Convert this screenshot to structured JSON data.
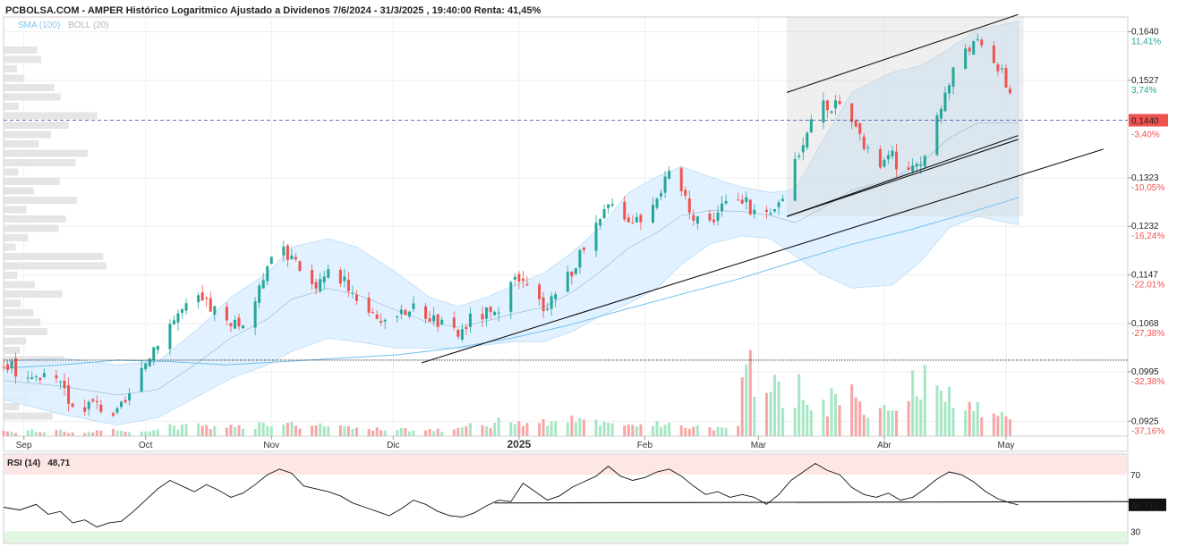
{
  "header": {
    "title": "PCBOLSA.COM - AMPER Histórico Logaritmico Ajustado a Dividenos 7/6/2024 - 31/3/2025 , 19:40:00 Renta: 41,45%",
    "indicator_sma": "SMA (100)",
    "indicator_boll": "BOLL (20)"
  },
  "colors": {
    "up": "#26a69a",
    "down": "#ef5350",
    "band_fill": "#dcefff",
    "sma": "#6fc0ee",
    "trend": "#111111",
    "price_line": "#3344aa",
    "vol_up": "#a6e6c4",
    "vol_down": "#f7a5a5",
    "rsi_line": "#111111",
    "rsi_over": "#fde6e6",
    "rsi_under": "#e2f7e2"
  },
  "chart_data": {
    "type": "candlestick",
    "x_range": [
      "2024-08-27",
      "2025-05-31"
    ],
    "y_scale": "log",
    "ylim": [
      0.0905,
      0.1676
    ],
    "y_ticks": [
      {
        "value": "0,1640",
        "pct": "11,41%"
      },
      {
        "value": "0,1527",
        "pct": "3,74%"
      },
      {
        "value": "0,1323",
        "pct": "-10,05%"
      },
      {
        "value": "0,1232",
        "pct": "-16,24%"
      },
      {
        "value": "0,1147",
        "pct": "-22,01%"
      },
      {
        "value": "0,1068",
        "pct": "-27,38%"
      },
      {
        "value": "0,0995",
        "pct": "-32,38%"
      },
      {
        "value": "0,0925",
        "pct": "-37,16%"
      }
    ],
    "y_tick_values": [
      0.164,
      0.1527,
      0.1323,
      0.1232,
      0.1147,
      0.1068,
      0.0995,
      0.0925
    ],
    "last_price": {
      "label": "0,1440",
      "pct": "-3,40%",
      "value": 0.144
    },
    "support_level": 0.1012,
    "x_ticks": [
      {
        "label": "Sep",
        "date": "2024-09-01",
        "bold": false
      },
      {
        "label": "Oct",
        "date": "2024-10-01",
        "bold": false
      },
      {
        "label": "Nov",
        "date": "2024-11-01",
        "bold": false
      },
      {
        "label": "Dic",
        "date": "2024-12-01",
        "bold": false
      },
      {
        "label": "2025",
        "date": "2025-01-01",
        "bold": true
      },
      {
        "label": "Feb",
        "date": "2025-02-01",
        "bold": false
      },
      {
        "label": "Mar",
        "date": "2025-03-01",
        "bold": false
      },
      {
        "label": "Abr",
        "date": "2025-04-01",
        "bold": false
      },
      {
        "label": "May",
        "date": "2025-05-01",
        "bold": false
      }
    ],
    "close_series": [
      [
        "2024-08-27",
        0.1005
      ],
      [
        "2024-09-03",
        0.099
      ],
      [
        "2024-09-10",
        0.0975
      ],
      [
        "2024-09-13",
        0.0945
      ],
      [
        "2024-09-18",
        0.095
      ],
      [
        "2024-09-24",
        0.0935
      ],
      [
        "2024-09-27",
        0.096
      ],
      [
        "2024-09-30",
        0.099
      ],
      [
        "2024-10-01",
        0.101
      ],
      [
        "2024-10-04",
        0.1045
      ],
      [
        "2024-10-09",
        0.1085
      ],
      [
        "2024-10-14",
        0.1105
      ],
      [
        "2024-10-18",
        0.109
      ],
      [
        "2024-10-22",
        0.106
      ],
      [
        "2024-10-25",
        0.107
      ],
      [
        "2024-10-29",
        0.112
      ],
      [
        "2024-10-31",
        0.1175
      ],
      [
        "2024-11-04",
        0.12
      ],
      [
        "2024-11-06",
        0.117
      ],
      [
        "2024-11-11",
        0.113
      ],
      [
        "2024-11-15",
        0.115
      ],
      [
        "2024-11-19",
        0.114
      ],
      [
        "2024-11-22",
        0.111
      ],
      [
        "2024-11-27",
        0.108
      ],
      [
        "2024-12-02",
        0.107
      ],
      [
        "2024-12-05",
        0.1095
      ],
      [
        "2024-12-10",
        0.108
      ],
      [
        "2024-12-14",
        0.106
      ],
      [
        "2024-12-17",
        0.105
      ],
      [
        "2024-12-20",
        0.1075
      ],
      [
        "2024-12-24",
        0.1085
      ],
      [
        "2024-12-27",
        0.1075
      ],
      [
        "2024-12-31",
        0.114
      ],
      [
        "2025-01-03",
        0.1125
      ],
      [
        "2025-01-07",
        0.1095
      ],
      [
        "2025-01-10",
        0.112
      ],
      [
        "2025-01-14",
        0.1155
      ],
      [
        "2025-01-17",
        0.119
      ],
      [
        "2025-01-21",
        0.124
      ],
      [
        "2025-01-24",
        0.1285
      ],
      [
        "2025-01-28",
        0.1245
      ],
      [
        "2025-01-31",
        0.125
      ],
      [
        "2025-02-04",
        0.1295
      ],
      [
        "2025-02-07",
        0.1325
      ],
      [
        "2025-02-10",
        0.13
      ],
      [
        "2025-02-13",
        0.1255
      ],
      [
        "2025-02-17",
        0.124
      ],
      [
        "2025-02-20",
        0.127
      ],
      [
        "2025-02-25",
        0.128
      ],
      [
        "2025-02-28",
        0.126
      ],
      [
        "2025-03-04",
        0.1245
      ],
      [
        "2025-03-07",
        0.129
      ],
      [
        "2025-03-10",
        0.136
      ],
      [
        "2025-03-13",
        0.142
      ],
      [
        "2025-03-16",
        0.148
      ],
      [
        "2025-03-20",
        0.147
      ],
      [
        "2025-03-24",
        0.143
      ],
      [
        "2025-03-27",
        0.138
      ],
      [
        "2025-03-31",
        0.135
      ],
      [
        "2025-04-03",
        0.1365
      ],
      [
        "2025-04-06",
        0.133
      ],
      [
        "2025-04-10",
        0.134
      ],
      [
        "2025-04-14",
        0.1455
      ],
      [
        "2025-04-17",
        0.152
      ],
      [
        "2025-04-20",
        0.1605
      ],
      [
        "2025-04-24",
        0.161
      ],
      [
        "2025-04-27",
        0.1595
      ],
      [
        "2025-04-30",
        0.154
      ],
      [
        "2025-05-02",
        0.15
      ],
      [
        "2025-05-04",
        0.144
      ]
    ],
    "bollinger": {
      "upper": [
        [
          "2024-08-27",
          0.101
        ],
        [
          "2024-09-10",
          0.1015
        ],
        [
          "2024-09-24",
          0.1005
        ],
        [
          "2024-10-04",
          0.101
        ],
        [
          "2024-10-14",
          0.106
        ],
        [
          "2024-10-22",
          0.111
        ],
        [
          "2024-10-31",
          0.115
        ],
        [
          "2024-11-06",
          0.1195
        ],
        [
          "2024-11-15",
          0.121
        ],
        [
          "2024-11-22",
          0.1195
        ],
        [
          "2024-12-02",
          0.115
        ],
        [
          "2024-12-10",
          0.111
        ],
        [
          "2024-12-17",
          0.1095
        ],
        [
          "2024-12-24",
          0.111
        ],
        [
          "2024-12-31",
          0.113
        ],
        [
          "2025-01-07",
          0.115
        ],
        [
          "2025-01-14",
          0.1185
        ],
        [
          "2025-01-21",
          0.123
        ],
        [
          "2025-01-28",
          0.1295
        ],
        [
          "2025-02-04",
          0.1325
        ],
        [
          "2025-02-10",
          0.1345
        ],
        [
          "2025-02-17",
          0.1325
        ],
        [
          "2025-02-25",
          0.1305
        ],
        [
          "2025-03-04",
          0.1295
        ],
        [
          "2025-03-10",
          0.13
        ],
        [
          "2025-03-16",
          0.1385
        ],
        [
          "2025-03-24",
          0.15
        ],
        [
          "2025-04-03",
          0.1545
        ],
        [
          "2025-04-10",
          0.156
        ],
        [
          "2025-04-17",
          0.16
        ],
        [
          "2025-04-24",
          0.1645
        ],
        [
          "2025-05-04",
          0.1665
        ]
      ],
      "lower": [
        [
          "2024-08-27",
          0.0955
        ],
        [
          "2024-09-10",
          0.0935
        ],
        [
          "2024-09-24",
          0.092
        ],
        [
          "2024-10-04",
          0.093
        ],
        [
          "2024-10-14",
          0.096
        ],
        [
          "2024-10-22",
          0.0985
        ],
        [
          "2024-10-31",
          0.1005
        ],
        [
          "2024-11-06",
          0.1025
        ],
        [
          "2024-11-15",
          0.1045
        ],
        [
          "2024-11-22",
          0.104
        ],
        [
          "2024-12-02",
          0.103
        ],
        [
          "2024-12-10",
          0.103
        ],
        [
          "2024-12-17",
          0.103
        ],
        [
          "2024-12-24",
          0.1035
        ],
        [
          "2024-12-31",
          0.104
        ],
        [
          "2025-01-07",
          0.104
        ],
        [
          "2025-01-14",
          0.1055
        ],
        [
          "2025-01-21",
          0.108
        ],
        [
          "2025-01-28",
          0.11
        ],
        [
          "2025-02-04",
          0.1125
        ],
        [
          "2025-02-10",
          0.1165
        ],
        [
          "2025-02-17",
          0.12
        ],
        [
          "2025-02-25",
          0.1215
        ],
        [
          "2025-03-04",
          0.121
        ],
        [
          "2025-03-10",
          0.118
        ],
        [
          "2025-03-16",
          0.115
        ],
        [
          "2025-03-24",
          0.1125
        ],
        [
          "2025-04-03",
          0.113
        ],
        [
          "2025-04-10",
          0.117
        ],
        [
          "2025-04-17",
          0.123
        ],
        [
          "2025-04-24",
          0.125
        ],
        [
          "2025-05-04",
          0.1235
        ]
      ]
    },
    "sma_100": [
      [
        "2024-08-27",
        0.1
      ],
      [
        "2024-09-10",
        0.1005
      ],
      [
        "2024-09-24",
        0.1012
      ],
      [
        "2024-10-07",
        0.101
      ],
      [
        "2024-10-21",
        0.1005
      ],
      [
        "2024-11-04",
        0.101
      ],
      [
        "2024-11-18",
        0.1015
      ],
      [
        "2024-12-02",
        0.102
      ],
      [
        "2024-12-16",
        0.103
      ],
      [
        "2024-12-30",
        0.1045
      ],
      [
        "2025-01-13",
        0.1065
      ],
      [
        "2025-01-27",
        0.109
      ],
      [
        "2025-02-10",
        0.1115
      ],
      [
        "2025-02-24",
        0.114
      ],
      [
        "2025-03-10",
        0.117
      ],
      [
        "2025-03-24",
        0.12
      ],
      [
        "2025-04-07",
        0.1225
      ],
      [
        "2025-04-21",
        0.1255
      ],
      [
        "2025-05-04",
        0.1285
      ]
    ],
    "trendlines": [
      {
        "from": [
          "2024-12-08",
          0.1008
        ],
        "to": [
          "2025-05-25",
          0.138
        ]
      },
      {
        "from": [
          "2025-03-08",
          0.125
        ],
        "to": [
          "2025-05-04",
          0.14
        ]
      },
      {
        "from": [
          "2025-03-08",
          0.15
        ],
        "to": [
          "2025-05-04",
          0.1682
        ]
      },
      {
        "from": [
          "2025-03-08",
          0.125
        ],
        "to": [
          "2025-05-04",
          0.1408
        ]
      }
    ],
    "volume": [
      0.05,
      0.04,
      0.05,
      0.06,
      0.05,
      0.07,
      0.06,
      0.04,
      0.03,
      0.04,
      0.05,
      0.06,
      0.05,
      0.04,
      0.05,
      0.06,
      0.08,
      0.1,
      0.09,
      0.11,
      0.12,
      0.1,
      0.09,
      0.12,
      0.11,
      0.1,
      0.09,
      0.12,
      0.1,
      0.11,
      0.13,
      0.09,
      0.1,
      0.12,
      0.11,
      0.09,
      0.08,
      0.1,
      0.09,
      0.07,
      0.08,
      0.06,
      0.07,
      0.05,
      0.06,
      0.07,
      0.08,
      0.06,
      0.07,
      0.1,
      0.12,
      0.1,
      0.14,
      0.16,
      0.15,
      0.13,
      0.12,
      0.14,
      0.16,
      0.15,
      0.18,
      0.16,
      0.14,
      0.13,
      0.12,
      0.11,
      0.1,
      0.12,
      0.14,
      0.12,
      0.1,
      0.11,
      0.12,
      0.1,
      0.09,
      0.08,
      0.1,
      0.09,
      0.55,
      0.7,
      0.4,
      0.62,
      0.48,
      0.35,
      0.5,
      0.38,
      0.3,
      0.26,
      0.4,
      0.45,
      0.35,
      0.28,
      0.22,
      0.25,
      0.3,
      0.28,
      0.55,
      0.42,
      0.6,
      0.48,
      0.4,
      0.3,
      0.35,
      0.28,
      0.26,
      0.24,
      0.22,
      0.18
    ],
    "rsi": {
      "label": "RSI (14)",
      "value": "48,71",
      "last_label": "48,713",
      "levels": [
        {
          "label": "70",
          "value": 70
        },
        {
          "label": "30",
          "value": 30
        }
      ],
      "ylim": [
        22,
        84
      ],
      "series": [
        [
          "2024-08-27",
          47
        ],
        [
          "2024-08-31",
          45
        ],
        [
          "2024-09-04",
          49
        ],
        [
          "2024-09-07",
          42
        ],
        [
          "2024-09-10",
          44
        ],
        [
          "2024-09-13",
          36
        ],
        [
          "2024-09-16",
          38
        ],
        [
          "2024-09-19",
          33
        ],
        [
          "2024-09-22",
          36
        ],
        [
          "2024-09-25",
          37
        ],
        [
          "2024-09-28",
          44
        ],
        [
          "2024-10-01",
          52
        ],
        [
          "2024-10-04",
          60
        ],
        [
          "2024-10-07",
          66
        ],
        [
          "2024-10-10",
          62
        ],
        [
          "2024-10-13",
          58
        ],
        [
          "2024-10-16",
          63
        ],
        [
          "2024-10-19",
          59
        ],
        [
          "2024-10-22",
          54
        ],
        [
          "2024-10-25",
          57
        ],
        [
          "2024-10-28",
          63
        ],
        [
          "2024-10-31",
          70
        ],
        [
          "2024-11-03",
          74
        ],
        [
          "2024-11-06",
          71
        ],
        [
          "2024-11-09",
          62
        ],
        [
          "2024-11-12",
          60
        ],
        [
          "2024-11-15",
          58
        ],
        [
          "2024-11-18",
          55
        ],
        [
          "2024-11-21",
          50
        ],
        [
          "2024-11-24",
          47
        ],
        [
          "2024-11-27",
          44
        ],
        [
          "2024-11-30",
          41
        ],
        [
          "2024-12-03",
          46
        ],
        [
          "2024-12-06",
          52
        ],
        [
          "2024-12-09",
          49
        ],
        [
          "2024-12-12",
          44
        ],
        [
          "2024-12-15",
          41
        ],
        [
          "2024-12-18",
          40
        ],
        [
          "2024-12-21",
          43
        ],
        [
          "2024-12-24",
          48
        ],
        [
          "2024-12-27",
          52
        ],
        [
          "2024-12-30",
          51
        ],
        [
          "2025-01-02",
          64
        ],
        [
          "2025-01-05",
          58
        ],
        [
          "2025-01-08",
          52
        ],
        [
          "2025-01-11",
          55
        ],
        [
          "2025-01-14",
          61
        ],
        [
          "2025-01-17",
          65
        ],
        [
          "2025-01-20",
          69
        ],
        [
          "2025-01-23",
          76
        ],
        [
          "2025-01-26",
          69
        ],
        [
          "2025-01-29",
          66
        ],
        [
          "2025-02-01",
          68
        ],
        [
          "2025-02-04",
          72
        ],
        [
          "2025-02-07",
          74
        ],
        [
          "2025-02-10",
          69
        ],
        [
          "2025-02-13",
          62
        ],
        [
          "2025-02-16",
          56
        ],
        [
          "2025-02-19",
          58
        ],
        [
          "2025-02-22",
          54
        ],
        [
          "2025-02-25",
          56
        ],
        [
          "2025-02-28",
          54
        ],
        [
          "2025-03-03",
          49
        ],
        [
          "2025-03-06",
          56
        ],
        [
          "2025-03-09",
          66
        ],
        [
          "2025-03-12",
          72
        ],
        [
          "2025-03-15",
          78
        ],
        [
          "2025-03-18",
          73
        ],
        [
          "2025-03-21",
          70
        ],
        [
          "2025-03-24",
          61
        ],
        [
          "2025-03-27",
          56
        ],
        [
          "2025-03-30",
          54
        ],
        [
          "2025-04-02",
          57
        ],
        [
          "2025-04-05",
          52
        ],
        [
          "2025-04-08",
          54
        ],
        [
          "2025-04-11",
          60
        ],
        [
          "2025-04-14",
          67
        ],
        [
          "2025-04-17",
          72
        ],
        [
          "2025-04-20",
          70
        ],
        [
          "2025-04-23",
          65
        ],
        [
          "2025-04-26",
          58
        ],
        [
          "2025-04-29",
          53
        ],
        [
          "2025-05-02",
          50
        ],
        [
          "2025-05-04",
          48.7
        ]
      ],
      "trendline": {
        "from": [
          "2024-12-26",
          50
        ],
        "to": [
          "2025-06-05",
          51
        ]
      }
    }
  }
}
